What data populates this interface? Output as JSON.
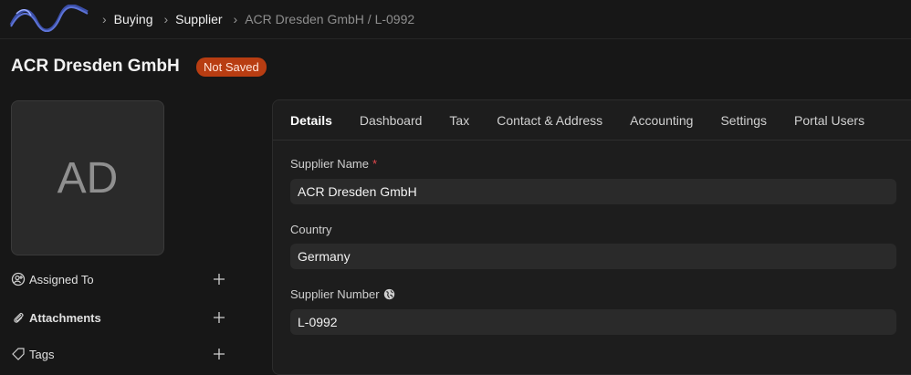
{
  "navbar": {
    "logo_icon": "app-logo-wave",
    "breadcrumbs": [
      "Buying",
      "Supplier",
      "ACR Dresden GmbH / L-0992"
    ]
  },
  "header": {
    "title": "ACR Dresden GmbH",
    "status": "Not Saved",
    "status_color": "#b83d12"
  },
  "sidebar": {
    "avatar_initials": "AD",
    "rows": [
      {
        "label": "Assigned To",
        "icon": "assign-user-icon"
      },
      {
        "label": "Attachments",
        "icon": "paperclip-icon"
      },
      {
        "label": "Tags",
        "icon": "tag-icon"
      }
    ]
  },
  "tabs": [
    "Details",
    "Dashboard",
    "Tax",
    "Contact & Address",
    "Accounting",
    "Settings",
    "Portal Users"
  ],
  "active_tab": "Details",
  "form": {
    "supplier_name": {
      "label": "Supplier Name",
      "value": "ACR Dresden GmbH",
      "required": true
    },
    "country": {
      "label": "Country",
      "value": "Germany"
    },
    "supplier_number": {
      "label": "Supplier Number",
      "value": "L-0992",
      "icon": "globe-icon"
    }
  }
}
